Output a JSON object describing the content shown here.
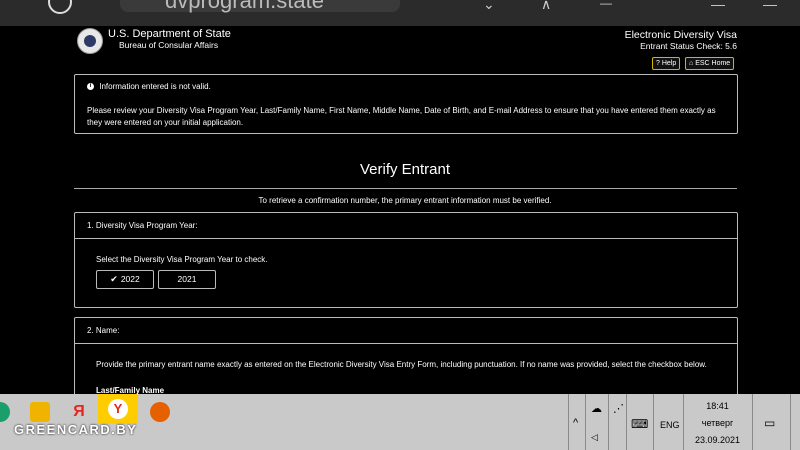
{
  "browser": {
    "url_fragment": "dvprogram.state",
    "download_icon": "download-icon",
    "profile_icon": "person-icon",
    "menu_icon": "menu-icon"
  },
  "header": {
    "dept_line1": "U.S. Department of State",
    "dept_line2": "Bureau of Consular Affairs",
    "app_title": "Electronic Diversity Visa",
    "app_subtitle": "Entrant Status Check: 5.6",
    "help_label": "Help",
    "home_label": "ESC Home"
  },
  "alert": {
    "title": "Information entered is not valid.",
    "message": "Please review your Diversity Visa Program Year, Last/Family Name, First Name, Middle Name, Date of Birth, and E-mail Address to ensure that you have entered them exactly as they were entered on your initial application."
  },
  "page": {
    "title": "Verify Entrant",
    "subtitle": "To retrieve a confirmation number, the primary entrant information must be verified."
  },
  "section1": {
    "header": "1. Diversity Visa Program Year:",
    "instruction": "Select the Diversity Visa Program Year to check.",
    "years": [
      "2022",
      "2021"
    ],
    "selected": "2022"
  },
  "section2": {
    "header": "2. Name:",
    "instruction": "Provide the primary entrant name exactly as entered on the Electronic Diversity Visa Entry Form, including punctuation. If no name was provided, select the checkbox below.",
    "field_label": "Last/Family Name"
  },
  "taskbar": {
    "watermark": "GREENCARD.BY",
    "lang": "ENG",
    "time": "18:41",
    "day": "четверг",
    "date": "23.09.2021"
  },
  "colors": {
    "accent_border": "#d4b400",
    "page_bg": "#000000",
    "taskbar_bg": "#c9c9c9"
  }
}
